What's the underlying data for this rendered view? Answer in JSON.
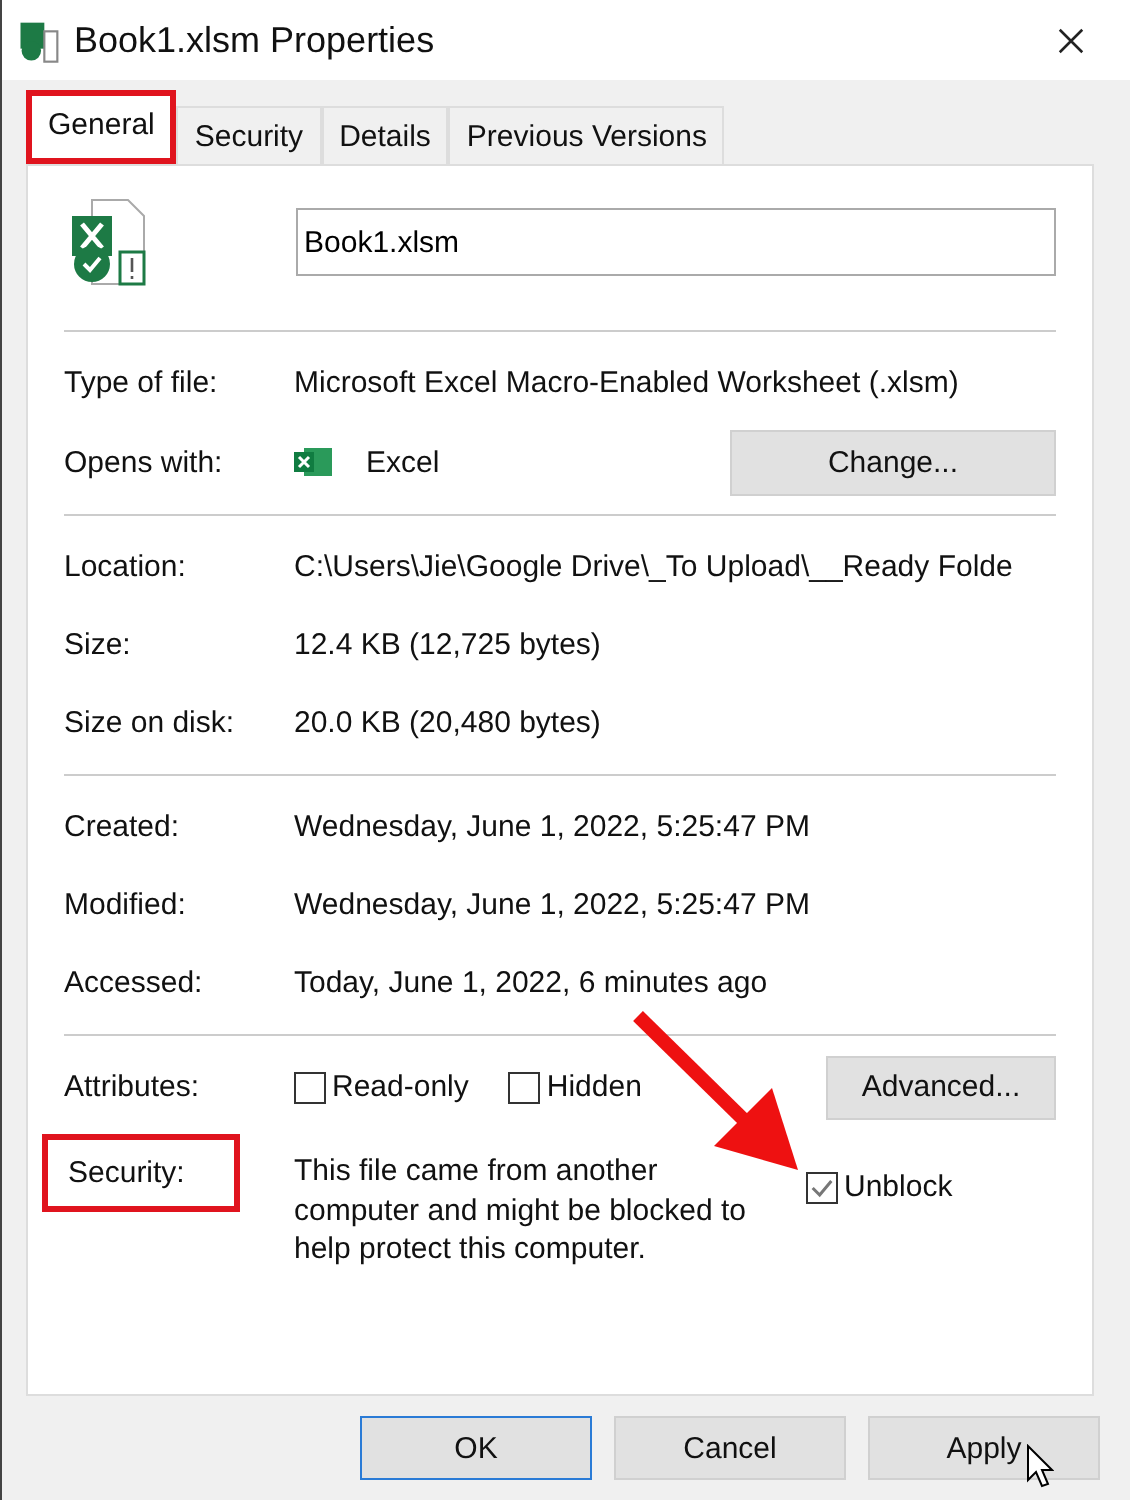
{
  "window": {
    "title": "Book1.xlsm Properties"
  },
  "tabs": [
    {
      "label": "General",
      "selected": true,
      "highlighted": true
    },
    {
      "label": "Security",
      "selected": false,
      "highlighted": false
    },
    {
      "label": "Details",
      "selected": false,
      "highlighted": false
    },
    {
      "label": "Previous Versions",
      "selected": false,
      "highlighted": false
    }
  ],
  "file_name": "Book1.xlsm",
  "sections": [
    [
      {
        "label": "Type of file:",
        "value": "Microsoft Excel Macro-Enabled Worksheet (.xlsm)",
        "kind": "text"
      },
      {
        "label": "Opens with:",
        "value": "Excel",
        "kind": "app",
        "button": "Change..."
      }
    ],
    [
      {
        "label": "Location:",
        "value": "C:\\Users\\Jie\\Google Drive\\_To Upload\\__Ready Folde",
        "kind": "text"
      },
      {
        "label": "Size:",
        "value": "12.4 KB (12,725 bytes)",
        "kind": "text"
      },
      {
        "label": "Size on disk:",
        "value": "20.0 KB (20,480 bytes)",
        "kind": "text"
      }
    ],
    [
      {
        "label": "Created:",
        "value": "Wednesday, June 1, 2022, 5:25:47 PM",
        "kind": "text"
      },
      {
        "label": "Modified:",
        "value": "Wednesday, June 1, 2022, 5:25:47 PM",
        "kind": "text"
      },
      {
        "label": "Accessed:",
        "value": "Today, June 1, 2022, 6 minutes ago",
        "kind": "text"
      }
    ]
  ],
  "attributes": {
    "label": "Attributes:",
    "checkboxes": [
      {
        "label": "Read-only",
        "checked": false
      },
      {
        "label": "Hidden",
        "checked": false
      }
    ],
    "button": "Advanced..."
  },
  "security": {
    "label": "Security:",
    "highlighted": true,
    "text": "This file came from another computer and might be blocked to help protect this computer.",
    "unblock": {
      "label": "Unblock",
      "checked": true,
      "arrow": true
    }
  },
  "buttons": [
    {
      "label": "OK",
      "default": true
    },
    {
      "label": "Cancel",
      "default": false
    },
    {
      "label": "Apply",
      "default": false,
      "pointer": true
    }
  ]
}
